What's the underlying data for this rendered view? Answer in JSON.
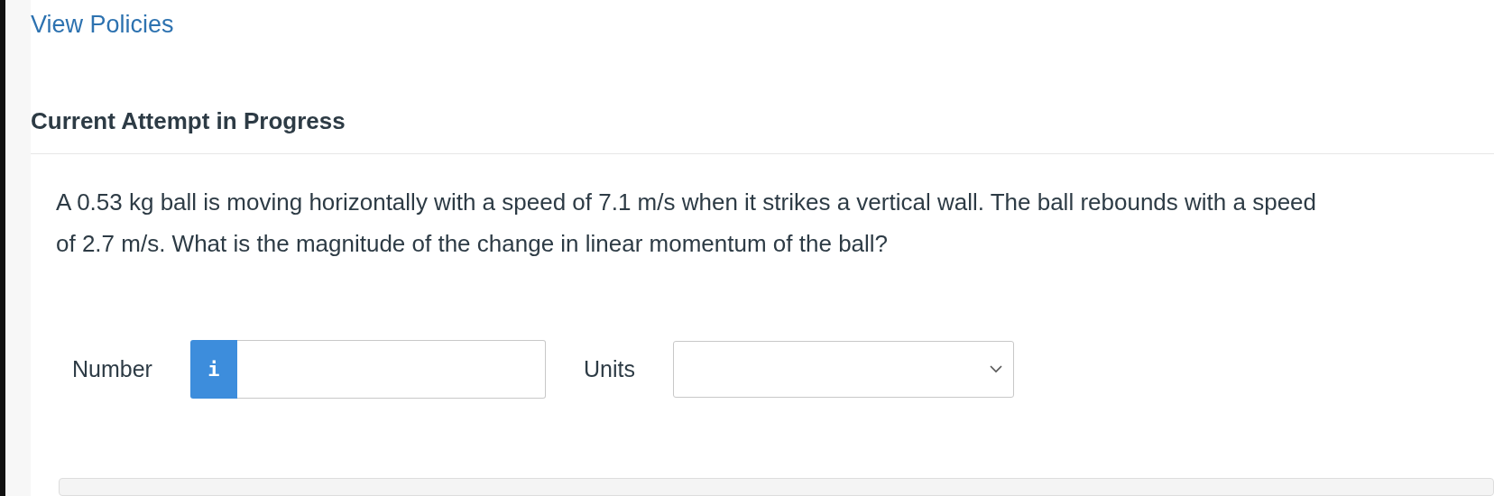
{
  "link": "View Policies",
  "heading": "Current Attempt in Progress",
  "question": "A 0.53 kg ball is moving horizontally with a speed of 7.1 m/s when it strikes a vertical wall. The ball rebounds with a speed of 2.7 m/s. What is the magnitude of the change in linear momentum of the ball?",
  "answer": {
    "number_label": "Number",
    "info_button": "i",
    "units_label": "Units"
  },
  "media_panel": {
    "kind": "panel"
  }
}
